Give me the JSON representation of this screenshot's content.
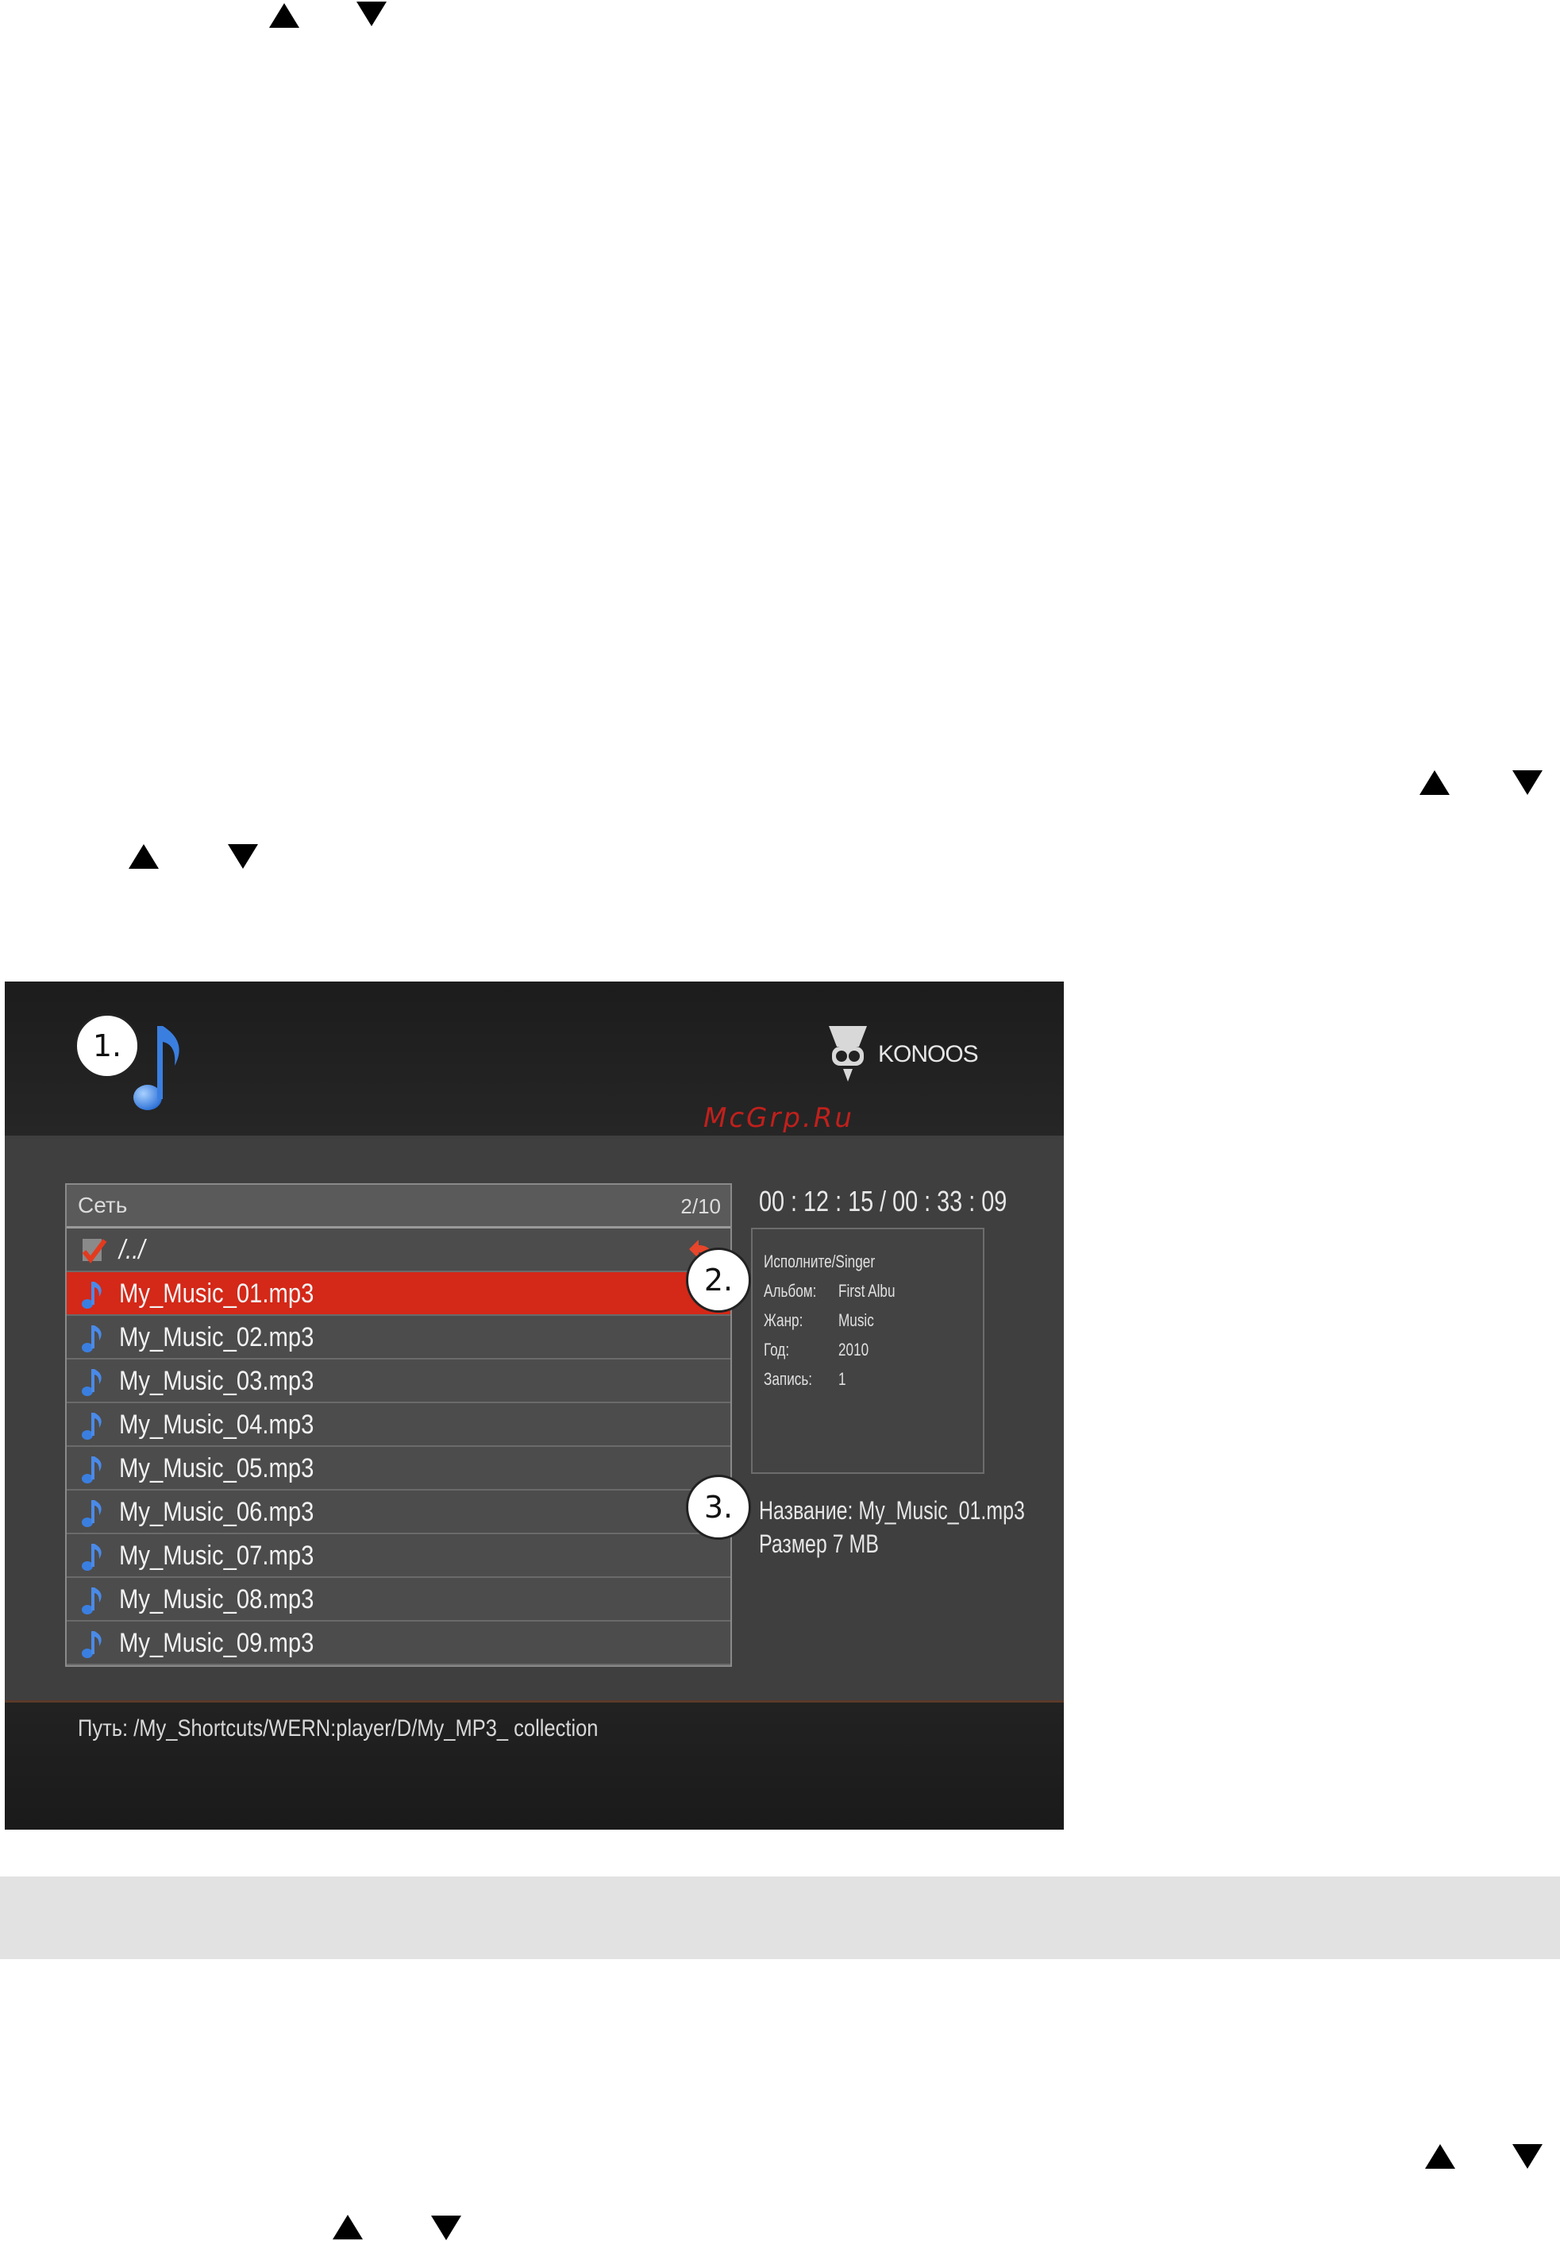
{
  "screen": {
    "brand": "KONOOS",
    "watermark": "McGrp.Ru",
    "list_header": {
      "title": "Сеть",
      "counter": "2/10"
    },
    "parent_dir": "/../",
    "files": [
      "My_Music_01.mp3",
      "My_Music_02.mp3",
      "My_Music_03.mp3",
      "My_Music_04.mp3",
      "My_Music_05.mp3",
      "My_Music_06.mp3",
      "My_Music_07.mp3",
      "My_Music_08.mp3",
      "My_Music_09.mp3"
    ],
    "selected_file": "My_Music_01.mp3",
    "time": "00 : 12 : 15 / 00 : 33 : 09",
    "info": [
      {
        "key": "Исполните/Singer",
        "value": ""
      },
      {
        "key": "Альбом:",
        "value": "First Albu"
      },
      {
        "key": "Жанр:",
        "value": "Music"
      },
      {
        "key": "Год:",
        "value": "2010"
      },
      {
        "key": "Запись:",
        "value": "1"
      }
    ],
    "file_name_line": "Название: My_Music_01.mp3",
    "file_size_line": "Размер 7 MB",
    "path": "Путь: /My_Shortcuts/WERN:player/D/My_MP3_ collection"
  },
  "callouts": [
    "1.",
    "2.",
    "3."
  ],
  "colors": {
    "selection": "#d42818",
    "screen_bg": "#3f3f3f",
    "note_blue": "#3a7fe0"
  }
}
